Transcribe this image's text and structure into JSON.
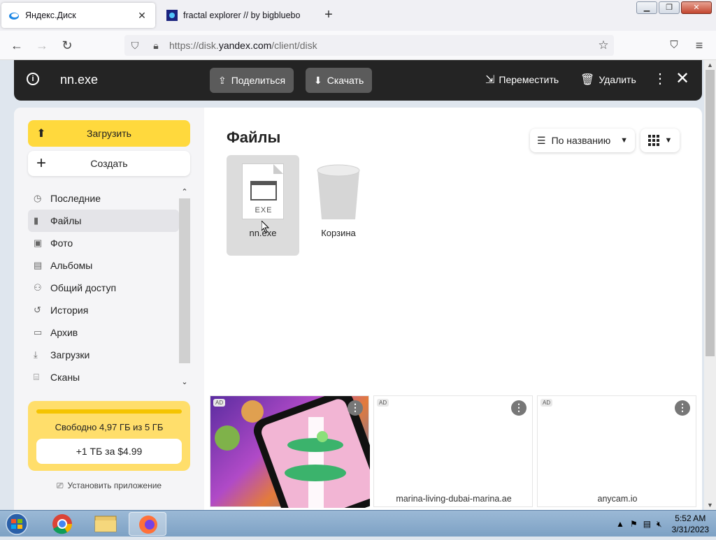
{
  "browser": {
    "tabs": [
      {
        "title": "Яндекс.Диск",
        "active": true
      },
      {
        "title": "fractal explorer // by bigbluebo",
        "active": false
      }
    ],
    "url_prefix": "https://disk.",
    "url_domain": "yandex.com",
    "url_suffix": "/client/disk"
  },
  "topbar": {
    "file_name": "nn.exe",
    "share_label": "Поделиться",
    "download_label": "Скачать",
    "move_label": "Переместить",
    "delete_label": "Удалить"
  },
  "sidebar": {
    "upload_label": "Загрузить",
    "create_label": "Создать",
    "items": [
      {
        "label": "Последние",
        "icon": "clock-icon"
      },
      {
        "label": "Файлы",
        "icon": "file-icon",
        "active": true
      },
      {
        "label": "Фото",
        "icon": "photo-icon"
      },
      {
        "label": "Альбомы",
        "icon": "album-icon"
      },
      {
        "label": "Общий доступ",
        "icon": "people-icon"
      },
      {
        "label": "История",
        "icon": "history-icon"
      },
      {
        "label": "Архив",
        "icon": "archive-icon"
      },
      {
        "label": "Загрузки",
        "icon": "download-icon"
      },
      {
        "label": "Сканы",
        "icon": "scan-icon"
      }
    ],
    "storage_text": "Свободно 4,97 ГБ из 5 ГБ",
    "buy_label": "+1 ТБ за $4.99",
    "install_label": "Установить приложение"
  },
  "main": {
    "title": "Файлы",
    "sort_label": "По названию",
    "files": [
      {
        "name": "nn.exe",
        "badge": "EXE",
        "selected": true
      },
      {
        "name": "Корзина",
        "selected": false
      }
    ],
    "ads": [
      {
        "tag": "AD",
        "domain": ""
      },
      {
        "tag": "AD",
        "domain": "marina-living-dubai-marina.ae"
      },
      {
        "tag": "AD",
        "domain": "anycam.io"
      }
    ]
  },
  "taskbar": {
    "time": "5:52 AM",
    "date": "3/31/2023"
  },
  "colors": {
    "accent_yellow": "#ffd93d",
    "dark_bar": "#242424"
  }
}
